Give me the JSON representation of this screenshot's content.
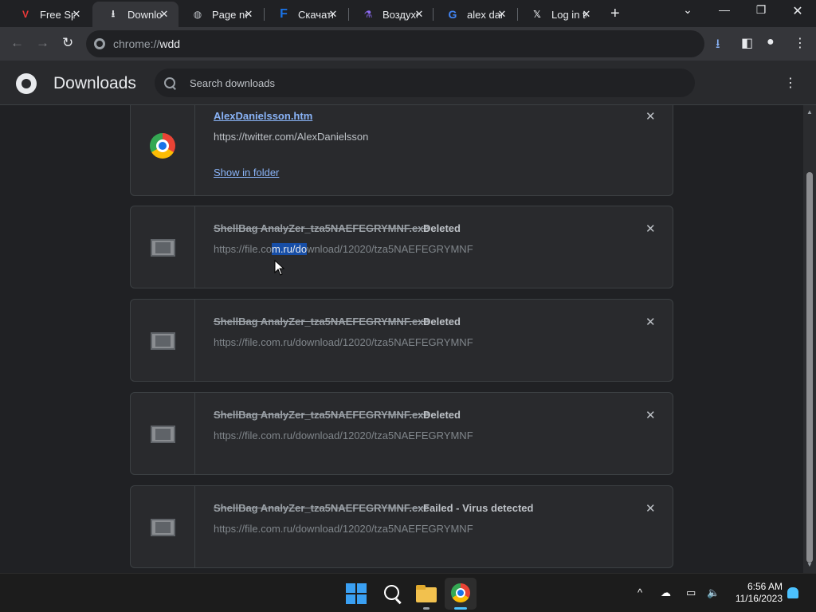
{
  "tabs": [
    {
      "title": "Free Spy",
      "icon": "vivaldi-icon",
      "glyph": "V",
      "color": "#ef3939"
    },
    {
      "title": "Downloads",
      "icon": "download-icon",
      "glyph": "⭳",
      "color": "#e8eaed"
    },
    {
      "title": "Page not",
      "icon": "globe-icon",
      "glyph": "◍",
      "color": "#bdc1c6"
    },
    {
      "title": "Скачать",
      "icon": "f-logo-icon",
      "glyph": "F",
      "color": "#1a73e8"
    },
    {
      "title": "Воздухо",
      "icon": "purple-logo-icon",
      "glyph": "⚗",
      "color": "#8e6cf5"
    },
    {
      "title": "alex dan",
      "icon": "google-icon",
      "glyph": "G",
      "color": "#4285f4"
    },
    {
      "title": "Log in to",
      "icon": "x-logo-icon",
      "glyph": "𝕏",
      "color": "#e8eaed"
    }
  ],
  "toolbar": {
    "url_scheme": "chrome://",
    "url_host": "wdd"
  },
  "downloads_page": {
    "title": "Downloads",
    "search_placeholder": "Search downloads"
  },
  "downloads": [
    {
      "file_name": "AlexDanielsson.htm",
      "url": "https://twitter.com/AlexDanielsson",
      "action": "Show in folder",
      "status": "",
      "icon": "chrome-file-icon"
    },
    {
      "file_name": "ShellBag AnalyZer_tza5NAEFEGRYMNF.exe",
      "status": "Deleted",
      "url_before": "https://file.co",
      "url_selected": "m.ru/do",
      "url_after": "wnload/12020/tza5NAEFEGRYMNF",
      "icon": "exe-file-icon"
    },
    {
      "file_name": "ShellBag AnalyZer_tza5NAEFEGRYMNF.exe",
      "status": "Deleted",
      "url": "https://file.com.ru/download/12020/tza5NAEFEGRYMNF",
      "icon": "exe-file-icon"
    },
    {
      "file_name": "ShellBag AnalyZer_tza5NAEFEGRYMNF.exe",
      "status": "Deleted",
      "url": "https://file.com.ru/download/12020/tza5NAEFEGRYMNF",
      "icon": "exe-file-icon"
    },
    {
      "file_name": "ShellBag AnalyZer_tza5NAEFEGRYMNF.exe",
      "status": "Failed - Virus detected",
      "url": "https://file.com.ru/download/12020/tza5NAEFEGRYMNF",
      "icon": "exe-file-icon"
    }
  ],
  "taskbar": {
    "time": "6:56 AM",
    "date": "11/16/2023"
  },
  "colors": {
    "background": "#202124",
    "card": "#292a2d",
    "link": "#8ab4f8",
    "selection": "#174ea6",
    "accent": "#4cc2ff"
  }
}
